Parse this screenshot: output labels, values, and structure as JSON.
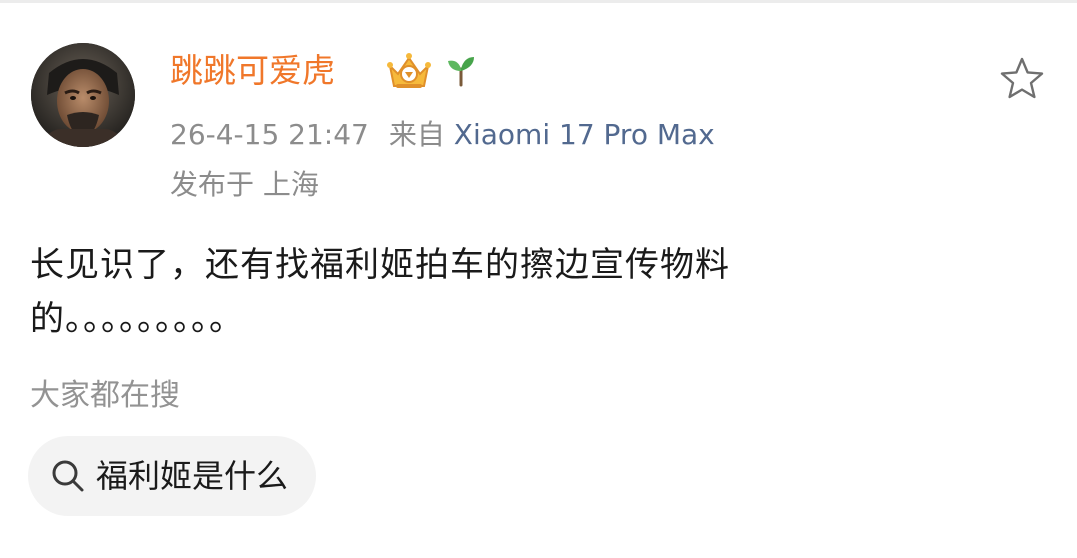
{
  "post": {
    "author": {
      "name": "跳跳可爱虎",
      "avatar_icon": "avatar-portrait",
      "badges": [
        "crown-badge-icon",
        "sprout-badge-icon"
      ],
      "name_color": "#f0772a"
    },
    "timestamp": "26-4-15 21:47",
    "source_label": "来自",
    "source_device": "Xiaomi 17 Pro Max",
    "location": "发布于 上海",
    "body_text": "长见识了，还有找福利姬拍车的擦边宣传物料的。。。。。。。。。",
    "favorite_icon": "star-outline-icon"
  },
  "search": {
    "heading": "大家都在搜",
    "suggestion": "福利姬是什么",
    "icon": "search-icon"
  },
  "colors": {
    "link": "#52698f",
    "meta": "#8c8c8c",
    "chip_bg": "#f3f3f3"
  }
}
